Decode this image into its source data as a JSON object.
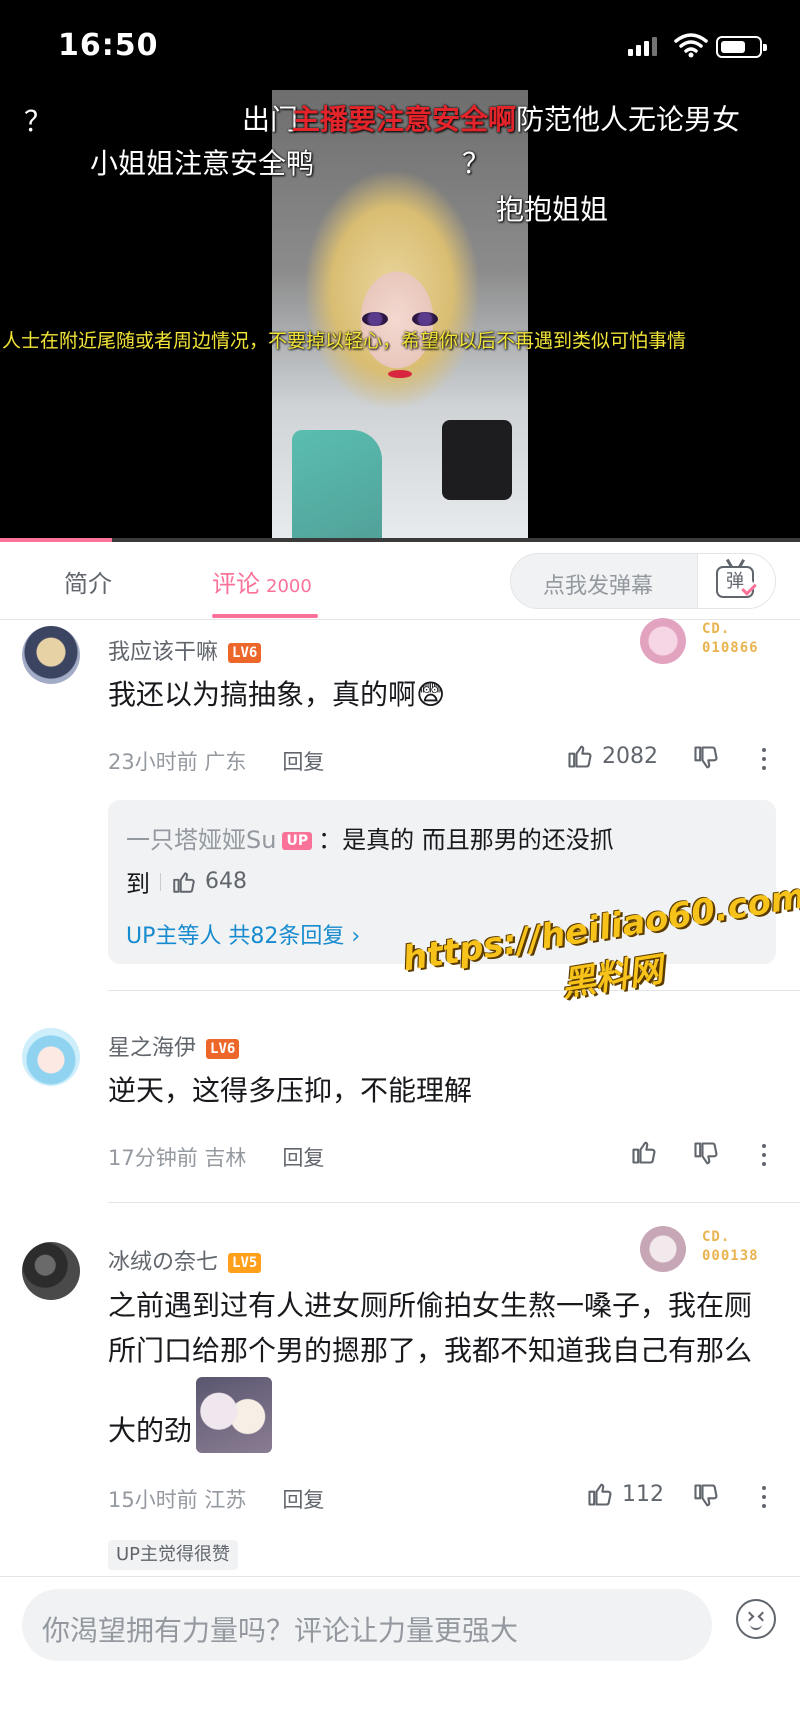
{
  "status_bar": {
    "time": "16:50"
  },
  "video": {
    "danmaku": [
      {
        "text": "？"
      },
      {
        "text": "出门"
      },
      {
        "text": "主播要注意安全啊"
      },
      {
        "text": "防范他人无论男女"
      },
      {
        "text": "小姐姐注意安全鸭"
      },
      {
        "text": "？"
      },
      {
        "text": "抱抱姐姐"
      },
      {
        "text": "人士在附近尾随或者周边情况，不要掉以轻心，希望你以后不再遇到类似可怕事情"
      }
    ],
    "progress": 0.14
  },
  "tabs": {
    "intro_label": "简介",
    "comments_label": "评论",
    "comments_count": "2000",
    "danmaku_placeholder": "点我发弹幕",
    "danmaku_toggle_glyph": "弹"
  },
  "comments": [
    {
      "username": "我应该干嘛",
      "level": "LV6",
      "text": "我还以为搞抽象，真的啊😨",
      "time": "23小时前",
      "location": "广东",
      "reply_label": "回复",
      "likes": "2082",
      "fan_badge": {
        "line1": "CD.",
        "line2": "010866"
      },
      "replies": {
        "author": "一只塔娅娅Su",
        "author_tag": "UP",
        "text_line1": "：是真的 而且那男的还没抓",
        "text_line2": "到",
        "likes": "648",
        "more_label": "UP主等人 共82条回复 ›"
      }
    },
    {
      "username": "星之海伊",
      "level": "LV6",
      "text": "逆天，这得多压抑，不能理解",
      "time": "17分钟前",
      "location": "吉林",
      "reply_label": "回复",
      "likes": ""
    },
    {
      "username": "冰绒の奈七",
      "level": "LV5",
      "text_line1": "之前遇到过有人进女厕所偷拍女生熬一嗓子，我在厕",
      "text_line2": "所门口给那个男的摁那了，我都不知道我自己有那么",
      "text_line3": "大的劲",
      "time": "15小时前",
      "location": "江苏",
      "reply_label": "回复",
      "likes": "112",
      "fan_badge": {
        "line1": "CD.",
        "line2": "000138"
      },
      "up_liked_tag": "UP主觉得很赞"
    }
  ],
  "watermark": {
    "line1": "https://heiliao60.com",
    "line2": "黑料网"
  },
  "bottom": {
    "input_placeholder": "你渴望拥有力量吗？评论让力量更强大"
  },
  "colors": {
    "accent": "#fb7299",
    "link": "#178bcf",
    "lv6": "#ee672a",
    "lv5": "#ff9f1a"
  }
}
